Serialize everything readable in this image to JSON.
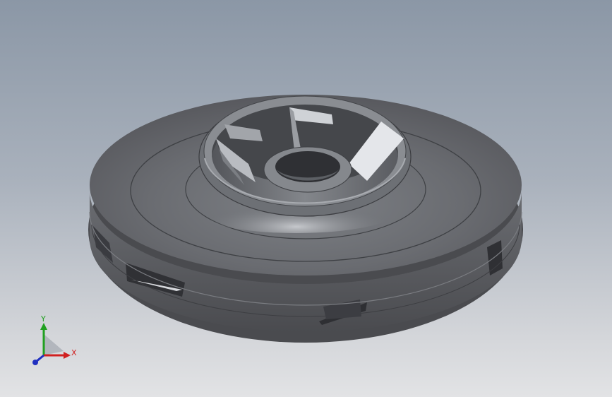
{
  "viewport": {
    "background_top": "#8b97a6",
    "background_bottom": "#e2e3e5"
  },
  "model": {
    "part_type": "impeller",
    "color": "#5f6166"
  },
  "triad": {
    "x_label": "X",
    "y_label": "Y",
    "x_color": "#d02020",
    "y_color": "#20a020",
    "z_color": "#2030c0"
  }
}
